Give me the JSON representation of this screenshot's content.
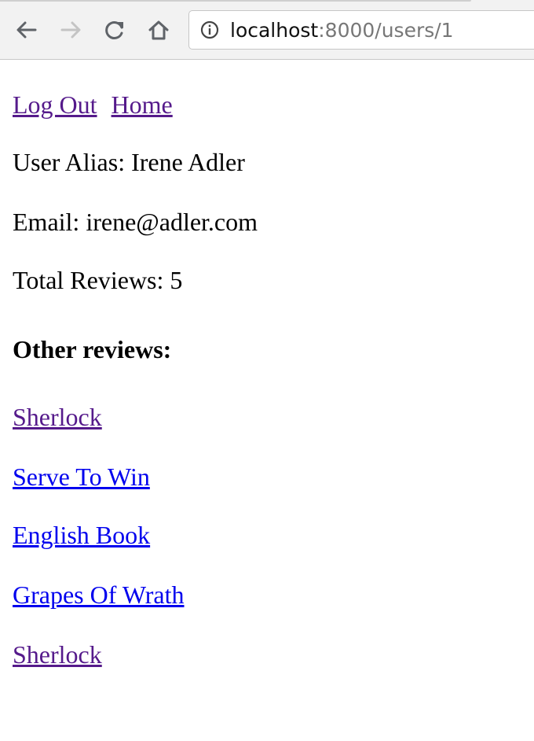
{
  "browser": {
    "url_host": "localhost",
    "url_path": ":8000/users/1"
  },
  "nav": {
    "logout_label": "Log Out",
    "home_label": "Home"
  },
  "user": {
    "alias_line": "User Alias: Irene Adler",
    "email_line": "Email: irene@adler.com",
    "total_reviews_line": "Total Reviews: 5"
  },
  "reviews": {
    "heading": "Other reviews:",
    "items": [
      {
        "label": "Sherlock",
        "visited": true
      },
      {
        "label": "Serve To Win",
        "visited": false
      },
      {
        "label": "English Book",
        "visited": false
      },
      {
        "label": "Grapes Of Wrath",
        "visited": false
      },
      {
        "label": "Sherlock",
        "visited": true
      }
    ]
  },
  "colors": {
    "link": "#0000ee",
    "visited_link": "#551a8b"
  }
}
